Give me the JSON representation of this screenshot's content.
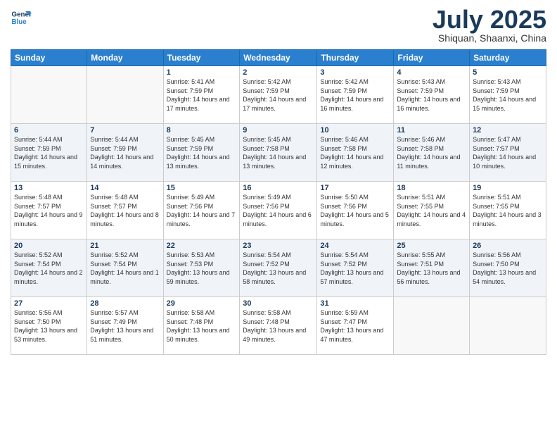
{
  "logo": {
    "line1": "General",
    "line2": "Blue"
  },
  "title": "July 2025",
  "location": "Shiquan, Shaanxi, China",
  "days_of_week": [
    "Sunday",
    "Monday",
    "Tuesday",
    "Wednesday",
    "Thursday",
    "Friday",
    "Saturday"
  ],
  "weeks": [
    [
      {
        "day": "",
        "info": ""
      },
      {
        "day": "",
        "info": ""
      },
      {
        "day": "1",
        "info": "Sunrise: 5:41 AM\nSunset: 7:59 PM\nDaylight: 14 hours and 17 minutes."
      },
      {
        "day": "2",
        "info": "Sunrise: 5:42 AM\nSunset: 7:59 PM\nDaylight: 14 hours and 17 minutes."
      },
      {
        "day": "3",
        "info": "Sunrise: 5:42 AM\nSunset: 7:59 PM\nDaylight: 14 hours and 16 minutes."
      },
      {
        "day": "4",
        "info": "Sunrise: 5:43 AM\nSunset: 7:59 PM\nDaylight: 14 hours and 16 minutes."
      },
      {
        "day": "5",
        "info": "Sunrise: 5:43 AM\nSunset: 7:59 PM\nDaylight: 14 hours and 15 minutes."
      }
    ],
    [
      {
        "day": "6",
        "info": "Sunrise: 5:44 AM\nSunset: 7:59 PM\nDaylight: 14 hours and 15 minutes."
      },
      {
        "day": "7",
        "info": "Sunrise: 5:44 AM\nSunset: 7:59 PM\nDaylight: 14 hours and 14 minutes."
      },
      {
        "day": "8",
        "info": "Sunrise: 5:45 AM\nSunset: 7:59 PM\nDaylight: 14 hours and 13 minutes."
      },
      {
        "day": "9",
        "info": "Sunrise: 5:45 AM\nSunset: 7:58 PM\nDaylight: 14 hours and 13 minutes."
      },
      {
        "day": "10",
        "info": "Sunrise: 5:46 AM\nSunset: 7:58 PM\nDaylight: 14 hours and 12 minutes."
      },
      {
        "day": "11",
        "info": "Sunrise: 5:46 AM\nSunset: 7:58 PM\nDaylight: 14 hours and 11 minutes."
      },
      {
        "day": "12",
        "info": "Sunrise: 5:47 AM\nSunset: 7:57 PM\nDaylight: 14 hours and 10 minutes."
      }
    ],
    [
      {
        "day": "13",
        "info": "Sunrise: 5:48 AM\nSunset: 7:57 PM\nDaylight: 14 hours and 9 minutes."
      },
      {
        "day": "14",
        "info": "Sunrise: 5:48 AM\nSunset: 7:57 PM\nDaylight: 14 hours and 8 minutes."
      },
      {
        "day": "15",
        "info": "Sunrise: 5:49 AM\nSunset: 7:56 PM\nDaylight: 14 hours and 7 minutes."
      },
      {
        "day": "16",
        "info": "Sunrise: 5:49 AM\nSunset: 7:56 PM\nDaylight: 14 hours and 6 minutes."
      },
      {
        "day": "17",
        "info": "Sunrise: 5:50 AM\nSunset: 7:56 PM\nDaylight: 14 hours and 5 minutes."
      },
      {
        "day": "18",
        "info": "Sunrise: 5:51 AM\nSunset: 7:55 PM\nDaylight: 14 hours and 4 minutes."
      },
      {
        "day": "19",
        "info": "Sunrise: 5:51 AM\nSunset: 7:55 PM\nDaylight: 14 hours and 3 minutes."
      }
    ],
    [
      {
        "day": "20",
        "info": "Sunrise: 5:52 AM\nSunset: 7:54 PM\nDaylight: 14 hours and 2 minutes."
      },
      {
        "day": "21",
        "info": "Sunrise: 5:52 AM\nSunset: 7:54 PM\nDaylight: 14 hours and 1 minute."
      },
      {
        "day": "22",
        "info": "Sunrise: 5:53 AM\nSunset: 7:53 PM\nDaylight: 13 hours and 59 minutes."
      },
      {
        "day": "23",
        "info": "Sunrise: 5:54 AM\nSunset: 7:52 PM\nDaylight: 13 hours and 58 minutes."
      },
      {
        "day": "24",
        "info": "Sunrise: 5:54 AM\nSunset: 7:52 PM\nDaylight: 13 hours and 57 minutes."
      },
      {
        "day": "25",
        "info": "Sunrise: 5:55 AM\nSunset: 7:51 PM\nDaylight: 13 hours and 56 minutes."
      },
      {
        "day": "26",
        "info": "Sunrise: 5:56 AM\nSunset: 7:50 PM\nDaylight: 13 hours and 54 minutes."
      }
    ],
    [
      {
        "day": "27",
        "info": "Sunrise: 5:56 AM\nSunset: 7:50 PM\nDaylight: 13 hours and 53 minutes."
      },
      {
        "day": "28",
        "info": "Sunrise: 5:57 AM\nSunset: 7:49 PM\nDaylight: 13 hours and 51 minutes."
      },
      {
        "day": "29",
        "info": "Sunrise: 5:58 AM\nSunset: 7:48 PM\nDaylight: 13 hours and 50 minutes."
      },
      {
        "day": "30",
        "info": "Sunrise: 5:58 AM\nSunset: 7:48 PM\nDaylight: 13 hours and 49 minutes."
      },
      {
        "day": "31",
        "info": "Sunrise: 5:59 AM\nSunset: 7:47 PM\nDaylight: 13 hours and 47 minutes."
      },
      {
        "day": "",
        "info": ""
      },
      {
        "day": "",
        "info": ""
      }
    ]
  ]
}
